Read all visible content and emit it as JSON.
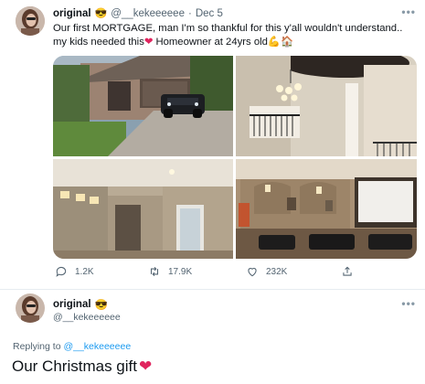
{
  "tweet": {
    "author_name": "original",
    "author_emoji": "😎",
    "author_handle": "@__kekeeeeee",
    "separator": "·",
    "date": "Dec 5",
    "more": "•••",
    "text_line1": "Our first MORTGAGE, man I'm so thankful for this y'all wouldn't understand..",
    "text_line2_a": "my kids needed this",
    "heart": "❤",
    "text_line2_b": " Homeowner at 24yrs old",
    "text_emojis": "💪🏠",
    "media": [
      {
        "description": "house-exterior-photo"
      },
      {
        "description": "foyer-chandelier-photo"
      },
      {
        "description": "hallway-photo"
      },
      {
        "description": "media-room-photo"
      }
    ],
    "actions": {
      "replies": "1.2K",
      "retweets": "17.9K",
      "likes": "232K"
    }
  },
  "reply": {
    "author_name": "original",
    "author_emoji": "😎",
    "author_handle": "@__kekeeeeee",
    "more": "•••",
    "replying_prefix": "Replying to ",
    "replying_mention": "@__kekeeeeee",
    "text": "Our Christmas gift",
    "heart": "❤"
  },
  "colors": {
    "link": "#1d9bf0",
    "muted": "#536471",
    "heart": "#e0245e"
  }
}
